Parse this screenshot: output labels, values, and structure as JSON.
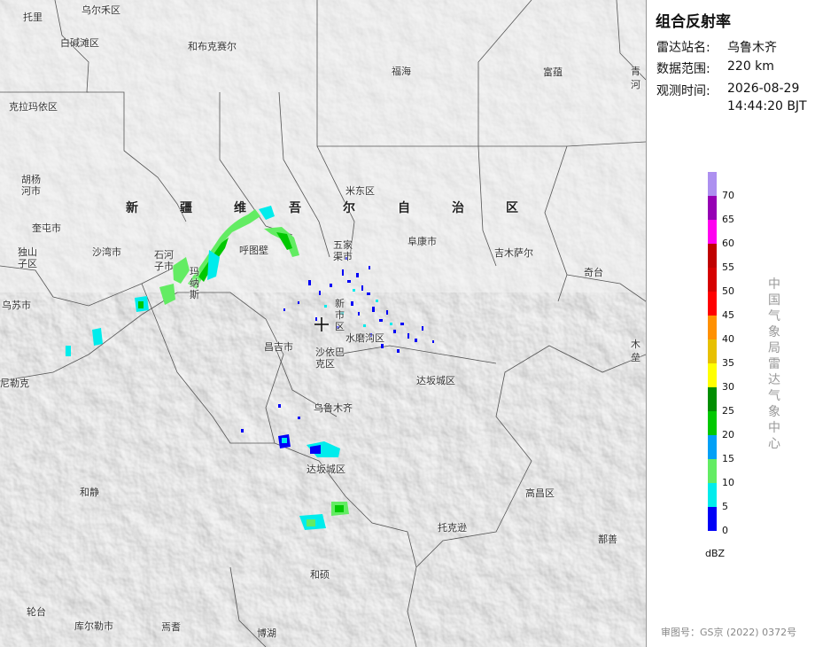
{
  "panel": {
    "title": "组合反射率",
    "station_label": "雷达站名:",
    "station": "乌鲁木齐",
    "range_label": "数据范围:",
    "range": "220 km",
    "time_label": "观测时间:",
    "time_date": "2026-08-29",
    "time_clock": "14:44:20 BJT",
    "agency": "中国气象局雷达气象中心",
    "approval": "审图号：GS京 (2022) 0372号"
  },
  "legend": {
    "unit": "dBZ",
    "ticks": [
      "70",
      "65",
      "60",
      "55",
      "50",
      "45",
      "40",
      "35",
      "30",
      "25",
      "20",
      "15",
      "10",
      "5",
      "0"
    ],
    "colors": [
      "#ad90f0",
      "#9600b4",
      "#ff00f0",
      "#c00000",
      "#d60000",
      "#ff0000",
      "#ff9000",
      "#e7c000",
      "#ffff00",
      "#008e00",
      "#00c800",
      "#01a0f6",
      "#63ec63",
      "#00ecec",
      "#0000f6"
    ]
  },
  "map": {
    "region_name": [
      "新",
      "疆",
      "维",
      "吾",
      "尔",
      "自",
      "治",
      "区"
    ],
    "places": {
      "tuoli": "托里",
      "wuerhe": "乌尔禾区",
      "baijiantan": "白碱滩区",
      "hebukesaier": "和布克赛尔",
      "fuhai": "福海",
      "fuyun": "富蕴",
      "qinghe_a": "青",
      "qinghe_b": "河",
      "kelamayi": "克拉玛依区",
      "huyanghe": "胡杨河市",
      "kuitun": "奎屯市",
      "dushanzi": "独山子区",
      "wusu": "乌苏市",
      "nileke": "尼勒克",
      "shawan": "沙湾市",
      "shihezi": "石河子市",
      "manasi": "玛纳斯",
      "hutubi": "呼图壁",
      "midong": "米东区",
      "wujiaqu": "五家渠市",
      "fukang": "阜康市",
      "jimusaer": "吉木萨尔",
      "qitai": "奇台",
      "mulei_a": "木",
      "mulei_b": "垒",
      "xinshi": "新市区",
      "changji": "昌吉市",
      "shuimogou": "水磨沟区",
      "shayibake": "沙依巴克区",
      "dabancheng_top": "达坂城区",
      "urumqi": "乌鲁木齐",
      "dabancheng": "达坂城区",
      "hejing": "和静",
      "gaochang": "高昌区",
      "tuokexun": "托克逊",
      "shanshan": "鄯善",
      "heshuo": "和硕",
      "luntai": "轮台",
      "kuerle": "库尔勒市",
      "yanqi": "焉耆",
      "bohu": "博湖"
    }
  }
}
